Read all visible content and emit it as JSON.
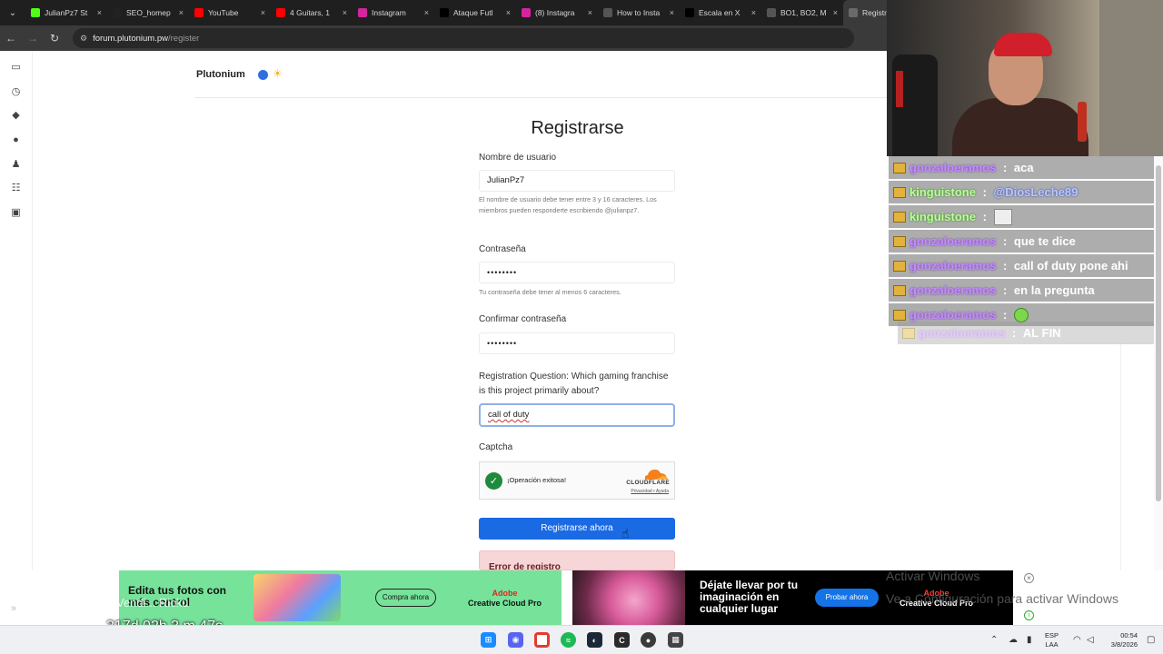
{
  "tabs": [
    {
      "label": "JulianPz7 St",
      "icon": "kick-icon",
      "color": "#53fc18"
    },
    {
      "label": "SEO_homep",
      "icon": "tiktok-icon",
      "color": "#222222"
    },
    {
      "label": "YouTube",
      "icon": "youtube-icon",
      "color": "#ff0000"
    },
    {
      "label": "4 Guitars, 1",
      "icon": "youtube-icon",
      "color": "#ff0000"
    },
    {
      "label": "Instagram",
      "icon": "instagram-icon",
      "color": "#d6249f"
    },
    {
      "label": "Ataque Futl",
      "icon": "x-icon",
      "color": "#000000"
    },
    {
      "label": "(8) Instagra",
      "icon": "instagram-icon",
      "color": "#d6249f"
    },
    {
      "label": "How to Insta",
      "icon": "generic-icon",
      "color": "#555555"
    },
    {
      "label": "Escala en X",
      "icon": "x-icon",
      "color": "#000000"
    },
    {
      "label": "BO1, BO2, M",
      "icon": "generic-icon",
      "color": "#555555"
    },
    {
      "label": "Registr",
      "icon": "plutonium-icon",
      "color": "#6a6a6a"
    }
  ],
  "address": {
    "host": "forum.plutonium.pw",
    "path": "/register"
  },
  "site": {
    "brand": "Plutonium"
  },
  "form": {
    "title": "Registrarse",
    "username_label": "Nombre de usuario",
    "username_value": "JulianPz7",
    "username_hint": "El nombre de usuario debe tener entre 3 y 16 caracteres. Los miembros pueden responderte escribiendo @julianpz7.",
    "password_label": "Contraseña",
    "password_value": "••••••••",
    "password_hint": "Tu contraseña debe tener al menos 6 caracteres.",
    "confirm_label": "Confirmar contraseña",
    "confirm_value": "••••••••",
    "question_label": "Registration Question: Which gaming franchise is this project primarily about?",
    "question_value": "call of duty",
    "captcha_label": "Captcha",
    "captcha_status": "¡Operación exitosa!",
    "captcha_brand": "CLOUDFLARE",
    "captcha_links": "Privacidad • Ayuda",
    "submit_label": "Registrarse ahora",
    "error_title": "Error de registro"
  },
  "chat": [
    {
      "user": "gonzaloeramos",
      "sep": " : ",
      "msg": "aca",
      "style": "purple"
    },
    {
      "user": "kinguistone",
      "sep": " : ",
      "msg": "@DiosLeche89",
      "style": "green",
      "mention": true
    },
    {
      "user": "kinguistone",
      "sep": " : ",
      "msg": "",
      "style": "green",
      "emote": "gray"
    },
    {
      "user": "gonzaloeramos",
      "sep": " : ",
      "msg": "que te dice",
      "style": "purple"
    },
    {
      "user": "gonzaloeramos",
      "sep": " : ",
      "msg": "call of duty pone ahi",
      "style": "purple"
    },
    {
      "user": "gonzaloeramos",
      "sep": " : ",
      "msg": "en la pregunta",
      "style": "purple"
    },
    {
      "user": "gonzaloeramos",
      "sep": " : ",
      "msg": "",
      "style": "purple",
      "emote": "green"
    },
    {
      "user": "gonzaloeramos",
      "sep": " : ",
      "msg": "AL FIN",
      "style": "purple",
      "faded": true
    }
  ],
  "ads": {
    "left_title": "Edita tus fotos con más control",
    "left_button": "Compra ahora",
    "left_brand_top": "Adobe",
    "left_brand_bottom": "Creative Cloud Pro",
    "right_title": "Déjate llevar por tu imaginación en cualquier lugar",
    "right_button": "Probar ahora",
    "right_brand_top": "Adobe",
    "right_brand_bottom": "Creative Cloud Pro"
  },
  "windows_watermark": {
    "line1": "Activar Windows",
    "line2": "Ve a Configuración para activar Windows"
  },
  "stream_overlay": {
    "text": "Vendi... Ricku",
    "timer": "317d 02h 3 m 47s"
  },
  "taskbar": {
    "lang_top": "ESP",
    "lang_bottom": "LAA",
    "time": "00:54",
    "date": "3/8/2026"
  }
}
